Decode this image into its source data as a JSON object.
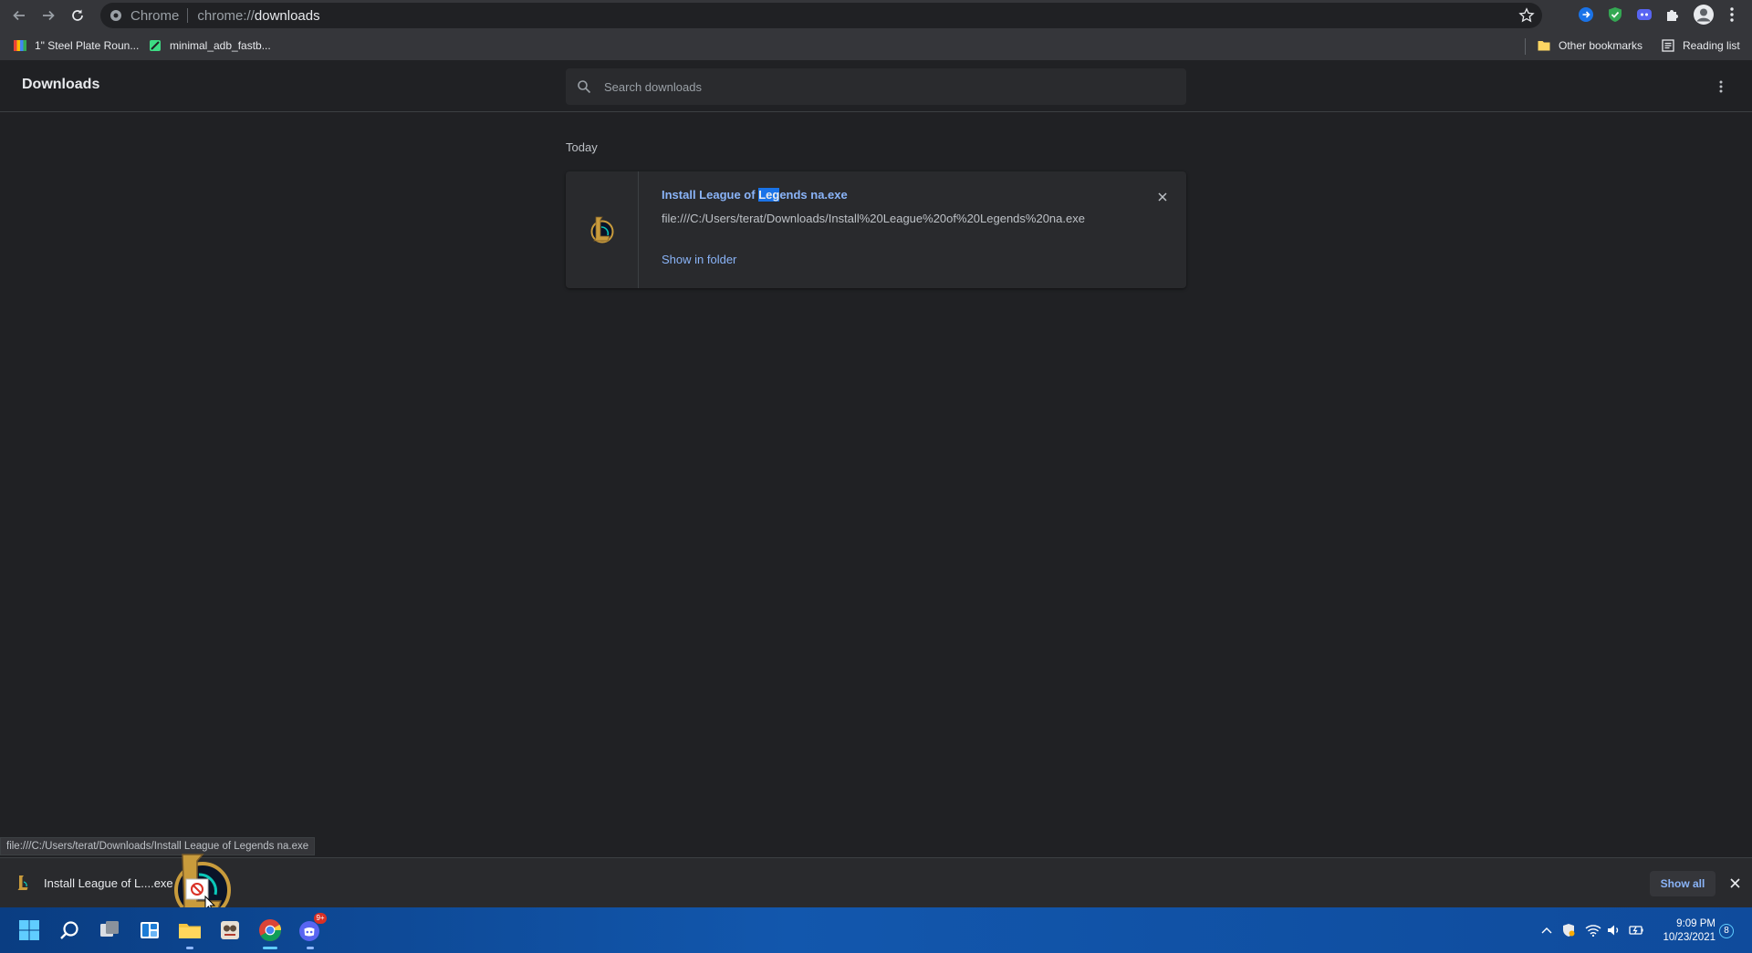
{
  "browser": {
    "omnibox": {
      "site_label": "Chrome",
      "url_prefix": "chrome://",
      "url_path": "downloads"
    },
    "nav": {
      "back": "back-icon",
      "forward": "forward-icon",
      "reload": "reload-icon"
    },
    "extensions": [
      "blue-extension-icon",
      "green-shield-extension-icon",
      "discord-extension-icon",
      "puzzle-extensions-icon"
    ]
  },
  "bookmarks": {
    "items": [
      {
        "label": "1\" Steel Plate Roun..."
      },
      {
        "label": "minimal_adb_fastb..."
      }
    ],
    "other_bookmarks": "Other bookmarks",
    "reading_list": "Reading list"
  },
  "downloads_page": {
    "title": "Downloads",
    "search_placeholder": "Search downloads",
    "section_label": "Today",
    "item": {
      "name_before": "Install League of ",
      "name_highlight": "Leg",
      "name_after": "ends na.exe",
      "url": "file:///C:/Users/terat/Downloads/Install%20League%20of%20Legends%20na.exe",
      "action_label": "Show in folder"
    }
  },
  "status_bar": {
    "url": "file:///C:/Users/terat/Downloads/Install League of Legends na.exe"
  },
  "download_shelf": {
    "item_label": "Install League of L....exe",
    "show_all_label": "Show all"
  },
  "taskbar": {
    "apps": [
      "windows-start-icon",
      "search-icon",
      "task-view-icon",
      "widgets-icon",
      "file-explorer-icon",
      "app-icon",
      "chrome-icon",
      "discord-icon"
    ],
    "discord_badge": "9+",
    "clock_time": "9:09 PM",
    "clock_date": "10/23/2021",
    "notification_count": "8"
  },
  "colors": {
    "accent": "#8ab4f8",
    "highlight": "#1a73e8",
    "page_bg": "#202124",
    "card_bg": "#292a2d",
    "toolbar_bg": "#35363a",
    "lol_gold": "#c89b3c",
    "taskbar_blue": "#1257ad"
  }
}
